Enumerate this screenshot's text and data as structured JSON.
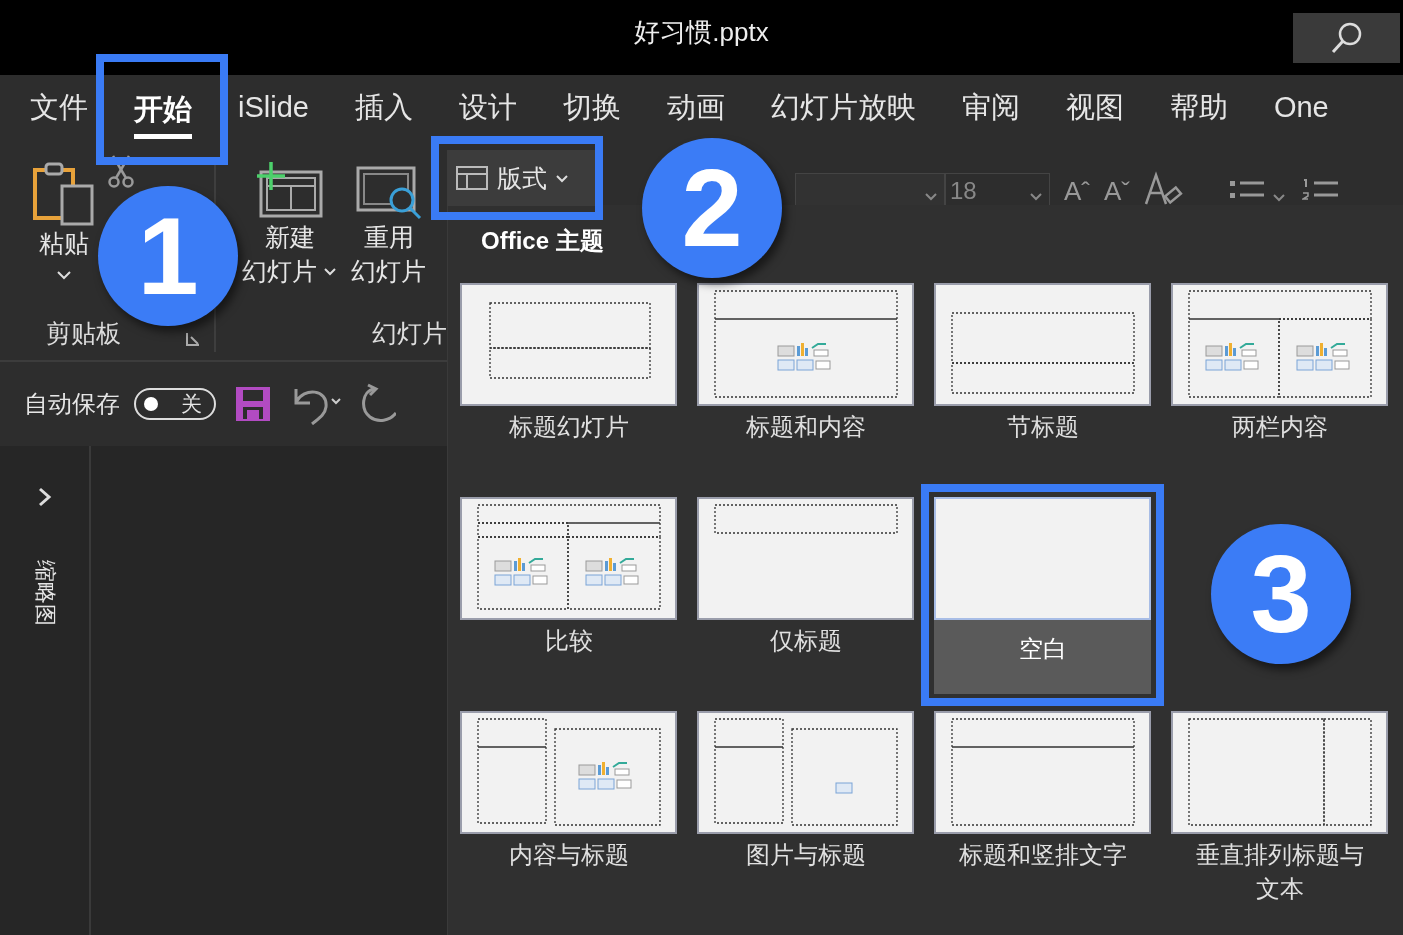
{
  "window": {
    "title": "好习惯.pptx"
  },
  "tabs": [
    {
      "label": "文件",
      "selected": false,
      "highlighted": false
    },
    {
      "label": "开始",
      "selected": true,
      "highlighted": true
    },
    {
      "label": "iSlide",
      "selected": false,
      "highlighted": false
    },
    {
      "label": "插入",
      "selected": false,
      "highlighted": false
    },
    {
      "label": "设计",
      "selected": false,
      "highlighted": false
    },
    {
      "label": "切换",
      "selected": false,
      "highlighted": false
    },
    {
      "label": "动画",
      "selected": false,
      "highlighted": false
    },
    {
      "label": "幻灯片放映",
      "selected": false,
      "highlighted": false
    },
    {
      "label": "审阅",
      "selected": false,
      "highlighted": false
    },
    {
      "label": "视图",
      "selected": false,
      "highlighted": false
    },
    {
      "label": "帮助",
      "selected": false,
      "highlighted": false
    },
    {
      "label": "One",
      "selected": false,
      "highlighted": false
    }
  ],
  "ribbon": {
    "paste_label": "粘贴",
    "clipboard_group": "剪贴板",
    "new_slide_label": [
      "新建",
      "幻灯片"
    ],
    "reuse_slide_label": [
      "重用",
      "幻灯片"
    ],
    "slides_group": "幻灯片",
    "layout_button": {
      "label": "版式",
      "highlighted": true
    },
    "font_size": "18",
    "font_buttons": [
      "Aˆ",
      "Aˇ"
    ]
  },
  "quick_access": {
    "autosave_label": "自动保存",
    "autosave_on": false,
    "toggle_text": "关"
  },
  "thumbnail_pane": {
    "label": "缩略图"
  },
  "layout_gallery": {
    "theme_heading": "Office 主题",
    "rows": [
      [
        {
          "label": "标题幻灯片",
          "kind": "title",
          "selected": false,
          "highlighted": false
        },
        {
          "label": "标题和内容",
          "kind": "title-content",
          "selected": false,
          "highlighted": false
        },
        {
          "label": "节标题",
          "kind": "section",
          "selected": false,
          "highlighted": false
        },
        {
          "label": "两栏内容",
          "kind": "two-content",
          "selected": false,
          "highlighted": false
        }
      ],
      [
        {
          "label": "比较",
          "kind": "comparison",
          "selected": false,
          "highlighted": false
        },
        {
          "label": "仅标题",
          "kind": "title-only",
          "selected": false,
          "highlighted": false
        },
        {
          "label": "空白",
          "kind": "blank",
          "selected": true,
          "highlighted": true
        }
      ],
      [
        {
          "label": "内容与标题",
          "kind": "content-caption",
          "selected": false,
          "highlighted": false
        },
        {
          "label": "图片与标题",
          "kind": "picture-caption",
          "selected": false,
          "highlighted": false
        },
        {
          "label": "标题和竖排文字",
          "kind": "vertical-title",
          "selected": false,
          "highlighted": false
        },
        {
          "label": "垂直排列标题与文本",
          "kind": "vertical-title-text",
          "selected": false,
          "highlighted": false
        }
      ]
    ]
  },
  "annotations": [
    {
      "number": "1"
    },
    {
      "number": "2"
    },
    {
      "number": "3"
    }
  ]
}
